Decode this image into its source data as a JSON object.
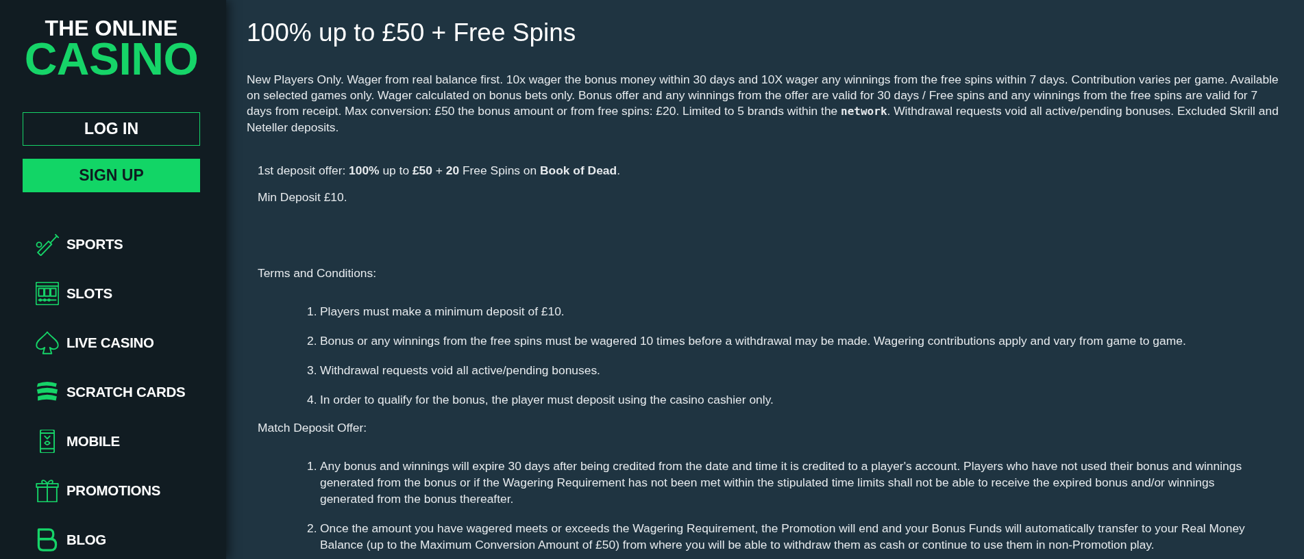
{
  "sidebar": {
    "logo": {
      "top_line": "THE ONLINE",
      "wordmark": "CASINO"
    },
    "buttons": [
      {
        "label": "LOG IN",
        "kind": "outline"
      },
      {
        "label": "SIGN UP",
        "kind": "filled"
      }
    ],
    "nav": [
      "SPORTS",
      "SLOTS",
      "LIVE CASINO",
      "SCRATCH CARDS",
      "MOBILE",
      "PROMOTIONS",
      "BLOG"
    ]
  },
  "promotion": {
    "title": "100% up to £50 + Free Spins",
    "terms_summary": "New Players Only. Wager from real balance first. 10x wager the bonus money within 30 days and 10X wager any winnings from the free spins within 7 days. Contribution varies per game. Available on selected games only. Wager calculated on bonus bets only. Bonus offer and any winnings from the offer are valid for 30 days / Free spins and any winnings from the free spins are valid for 7 days from receipt. Max conversion: £50 the bonus amount or from free spins: £20. Limited to 5 brands within the **network**. Withdrawal requests void all active/pending bonuses. Excluded Skrill and Neteller deposits.",
    "offer": "1st deposit offer: **100%** up to **£50** + **20** Free Spins on **Book of Dead**.",
    "min_deposit": "Min Deposit £10.",
    "sections": [
      {
        "heading": "Terms and Conditions:",
        "items": [
          {
            "number": "1.",
            "text": "Players must make a minimum deposit of £10."
          },
          {
            "number": "2.",
            "text": "Bonus or any winnings from the free spins must be wagered 10 times before a withdrawal may be made. Wagering contributions apply and vary from game to game."
          },
          {
            "number": "3.",
            "text": "Withdrawal requests void all active/pending bonuses."
          },
          {
            "number": "4.",
            "text": "In order to qualify for the bonus, the player must deposit using the casino cashier only."
          }
        ]
      },
      {
        "heading": "Match Deposit Offer:",
        "items": [
          {
            "number": "1.",
            "text": "Any bonus and winnings will expire 30 days after being credited from the date and time it is credited to a player's account. Players who have not used their bonus and winnings generated from the bonus or if the Wagering Requirement has not been met within the stipulated time limits shall not be able to receive the expired bonus and/or winnings generated from the bonus thereafter."
          },
          {
            "number": "2.",
            "text": "Once the amount you have wagered meets or exceeds the Wagering Requirement, the Promotion will end and your Bonus Funds will automatically transfer to your Real Money Balance (up to the Maximum Conversion Amount of £50) from where you will be able to withdraw them as cash or continue to use them in non-Promotion play."
          }
        ]
      }
    ]
  }
}
